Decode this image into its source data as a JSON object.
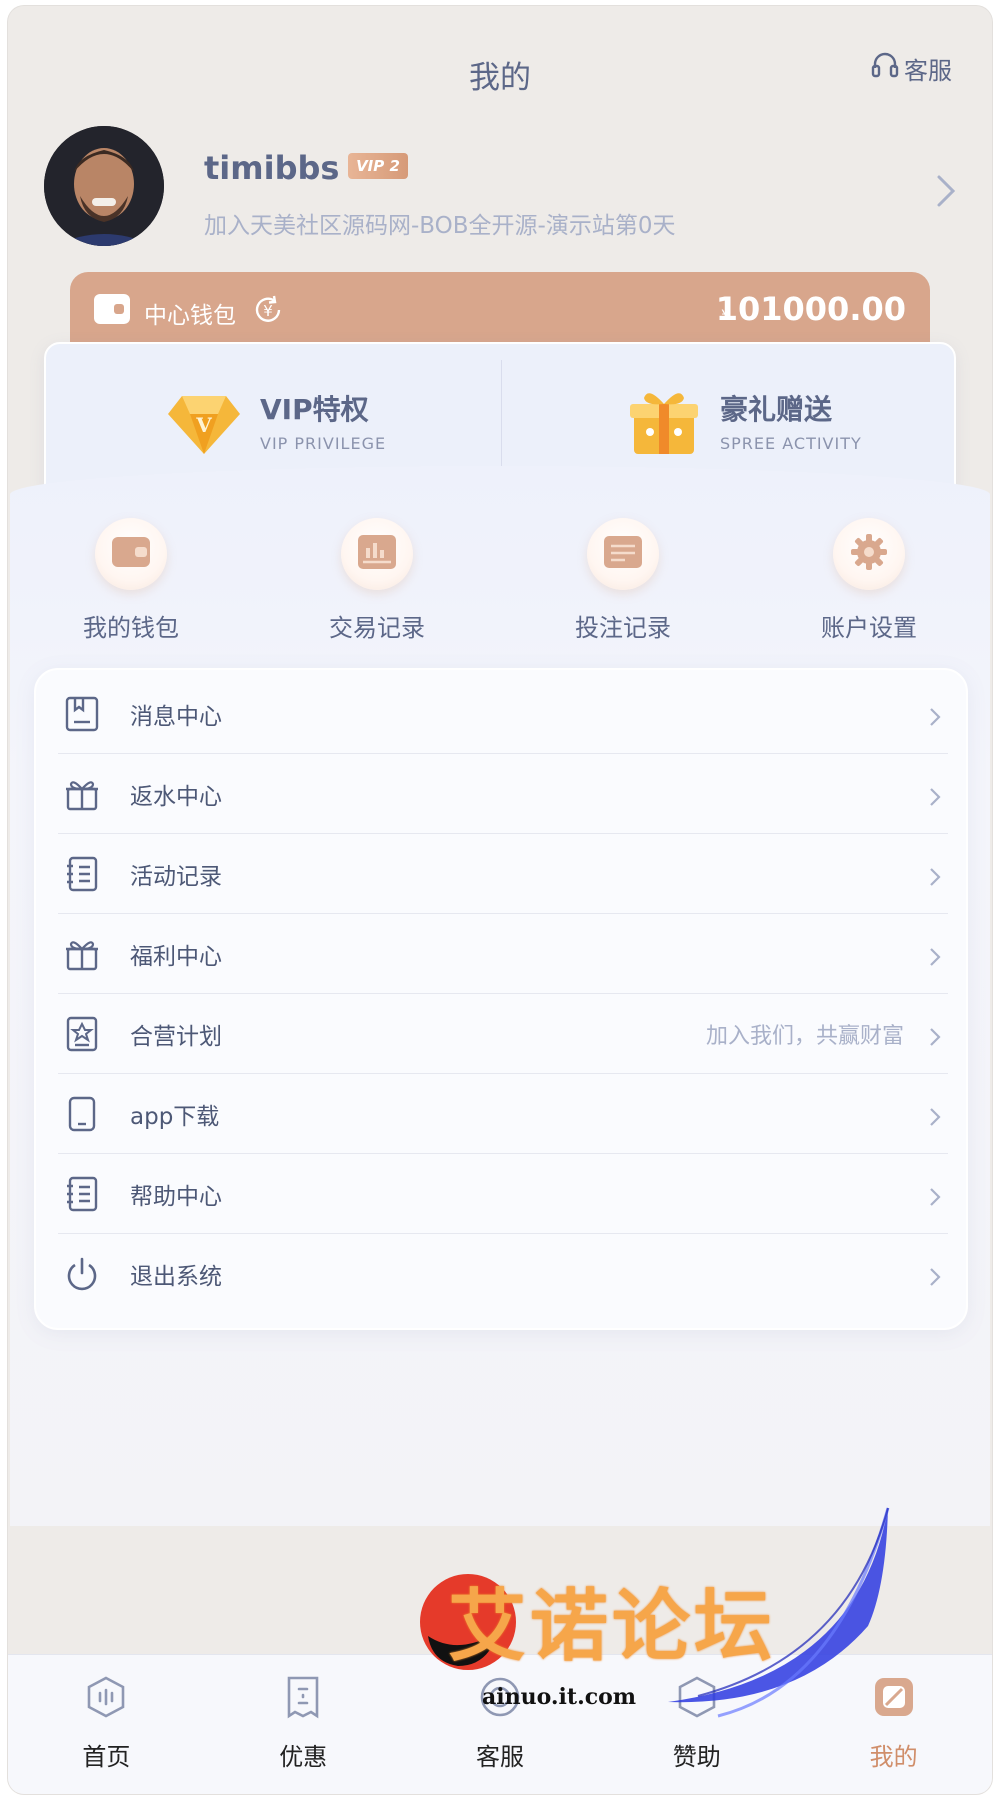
{
  "header": {
    "title": "我的",
    "customer_service": "客服"
  },
  "profile": {
    "username": "timibbs",
    "vip_level": "VIP 2",
    "subtitle": "加入天美社区源码网-BOB全开源-演示站第0天"
  },
  "wallet": {
    "label": "中心钱包",
    "currency": "¥",
    "balance": "101000.00"
  },
  "privileges": [
    {
      "title": "VIP特权",
      "subtitle": "VIP PRIVILEGE"
    },
    {
      "title": "豪礼赠送",
      "subtitle": "SPREE ACTIVITY"
    }
  ],
  "quick_actions": [
    {
      "label": "我的钱包",
      "icon": "wallet-icon"
    },
    {
      "label": "交易记录",
      "icon": "transaction-icon"
    },
    {
      "label": "投注记录",
      "icon": "bet-record-icon"
    },
    {
      "label": "账户设置",
      "icon": "gear-icon"
    }
  ],
  "menu": [
    {
      "label": "消息中心",
      "icon": "message-icon",
      "hint": ""
    },
    {
      "label": "返水中心",
      "icon": "gift-icon",
      "hint": ""
    },
    {
      "label": "活动记录",
      "icon": "list-icon",
      "hint": ""
    },
    {
      "label": "福利中心",
      "icon": "gift-icon",
      "hint": ""
    },
    {
      "label": "合营计划",
      "icon": "partner-icon",
      "hint": "加入我们，共赢财富"
    },
    {
      "label": "app下载",
      "icon": "phone-icon",
      "hint": ""
    },
    {
      "label": "帮助中心",
      "icon": "list-icon",
      "hint": ""
    },
    {
      "label": "退出系统",
      "icon": "power-icon",
      "hint": ""
    }
  ],
  "bottom_nav": [
    {
      "label": "首页",
      "icon": "home-icon",
      "active": false
    },
    {
      "label": "优惠",
      "icon": "coupon-icon",
      "active": false
    },
    {
      "label": "客服",
      "icon": "headset-icon",
      "active": false
    },
    {
      "label": "赞助",
      "icon": "sponsor-icon",
      "active": false
    },
    {
      "label": "我的",
      "icon": "profile-icon",
      "active": true
    }
  ],
  "watermark": {
    "text": "艾诺论坛",
    "url": "ainuo.it.com"
  },
  "colors": {
    "accent": "#d8a68c",
    "text_primary": "#5c6788",
    "text_muted": "#a9b1c9",
    "active_tab": "#d08e6a"
  }
}
